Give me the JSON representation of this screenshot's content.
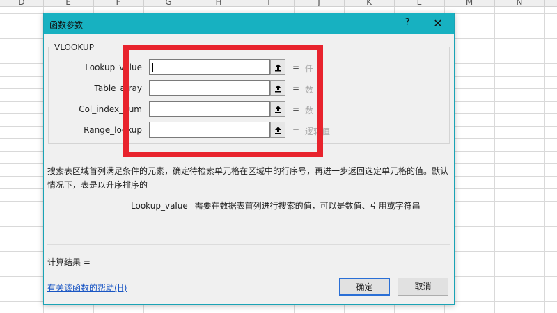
{
  "spreadsheet": {
    "columns": [
      "D",
      "E",
      "F",
      "G",
      "H",
      "I",
      "J",
      "K",
      "L",
      "M",
      "N"
    ]
  },
  "dialog": {
    "title": "函数参数",
    "help_label": "?",
    "close_label": "✕",
    "function_name": "VLOOKUP",
    "arguments": [
      {
        "label": "Lookup_value",
        "value": "",
        "hint": "任"
      },
      {
        "label": "Table_array",
        "value": "",
        "hint": "数"
      },
      {
        "label": "Col_index_num",
        "value": "",
        "hint": "数"
      },
      {
        "label": "Range_lookup",
        "value": "",
        "hint": "逻辑值"
      }
    ],
    "equals": "=",
    "result_equals": "=",
    "description": "搜索表区域首列满足条件的元素，确定待检索单元格在区域中的行序号，再进一步返回选定单元格的值。默认情况下，表是以升序排序的",
    "param_name": "Lookup_value",
    "param_description": "需要在数据表首列进行搜索的值，可以是数值、引用或字符串",
    "calc_result": "计算结果 =",
    "help_link": "有关该函数的帮助(H)",
    "ok_label": "确定",
    "cancel_label": "取消"
  },
  "colors": {
    "titlebar": "#17b1c1",
    "highlight": "#e8232d",
    "link": "#1a56c4",
    "ok_border": "#2a6fd6"
  }
}
